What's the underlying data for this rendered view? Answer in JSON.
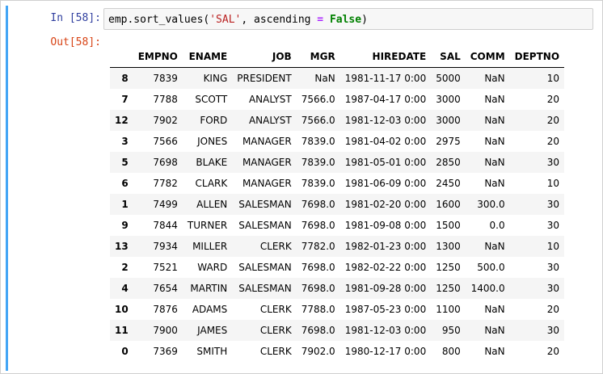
{
  "cell": {
    "in_prompt": "In [58]:",
    "out_prompt": "Out[58]:",
    "code": {
      "call": "emp.sort_values(",
      "arg_str": "'SAL'",
      "sep": ", ascending ",
      "op": "=",
      "space": " ",
      "kw": "False",
      "close": ")"
    }
  },
  "table": {
    "columns": [
      "",
      "EMPNO",
      "ENAME",
      "JOB",
      "MGR",
      "HIREDATE",
      "SAL",
      "COMM",
      "DEPTNO"
    ],
    "rows": [
      [
        "8",
        "7839",
        "KING",
        "PRESIDENT",
        "NaN",
        "1981-11-17 0:00",
        "5000",
        "NaN",
        "10"
      ],
      [
        "7",
        "7788",
        "SCOTT",
        "ANALYST",
        "7566.0",
        "1987-04-17 0:00",
        "3000",
        "NaN",
        "20"
      ],
      [
        "12",
        "7902",
        "FORD",
        "ANALYST",
        "7566.0",
        "1981-12-03 0:00",
        "3000",
        "NaN",
        "20"
      ],
      [
        "3",
        "7566",
        "JONES",
        "MANAGER",
        "7839.0",
        "1981-04-02 0:00",
        "2975",
        "NaN",
        "20"
      ],
      [
        "5",
        "7698",
        "BLAKE",
        "MANAGER",
        "7839.0",
        "1981-05-01 0:00",
        "2850",
        "NaN",
        "30"
      ],
      [
        "6",
        "7782",
        "CLARK",
        "MANAGER",
        "7839.0",
        "1981-06-09 0:00",
        "2450",
        "NaN",
        "10"
      ],
      [
        "1",
        "7499",
        "ALLEN",
        "SALESMAN",
        "7698.0",
        "1981-02-20 0:00",
        "1600",
        "300.0",
        "30"
      ],
      [
        "9",
        "7844",
        "TURNER",
        "SALESMAN",
        "7698.0",
        "1981-09-08 0:00",
        "1500",
        "0.0",
        "30"
      ],
      [
        "13",
        "7934",
        "MILLER",
        "CLERK",
        "7782.0",
        "1982-01-23 0:00",
        "1300",
        "NaN",
        "10"
      ],
      [
        "2",
        "7521",
        "WARD",
        "SALESMAN",
        "7698.0",
        "1982-02-22 0:00",
        "1250",
        "500.0",
        "30"
      ],
      [
        "4",
        "7654",
        "MARTIN",
        "SALESMAN",
        "7698.0",
        "1981-09-28 0:00",
        "1250",
        "1400.0",
        "30"
      ],
      [
        "10",
        "7876",
        "ADAMS",
        "CLERK",
        "7788.0",
        "1987-05-23 0:00",
        "1100",
        "NaN",
        "20"
      ],
      [
        "11",
        "7900",
        "JAMES",
        "CLERK",
        "7698.0",
        "1981-12-03 0:00",
        "950",
        "NaN",
        "30"
      ],
      [
        "0",
        "7369",
        "SMITH",
        "CLERK",
        "7902.0",
        "1980-12-17 0:00",
        "800",
        "NaN",
        "20"
      ]
    ]
  }
}
